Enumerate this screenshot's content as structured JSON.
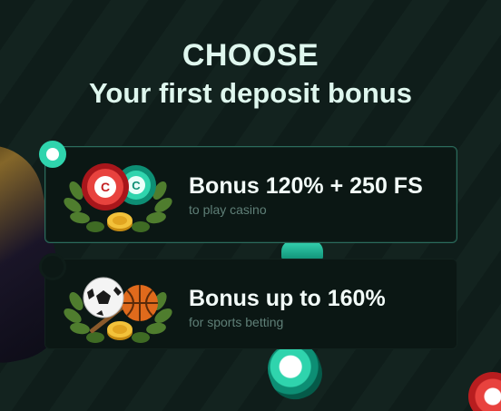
{
  "header": {
    "title_line1": "CHOOSE",
    "title_line2": "Your first deposit bonus"
  },
  "options": [
    {
      "title": "Bonus 120% + 250 FS",
      "subtitle": "to play casino",
      "selected": true,
      "illustration": "casino-chips-icon"
    },
    {
      "title": "Bonus up to 160%",
      "subtitle": "for sports betting",
      "selected": false,
      "illustration": "sports-balls-icon"
    }
  ],
  "colors": {
    "accent": "#2fd4ad",
    "card_bg": "#0b1714",
    "selected_border": "#2b6b5c",
    "title_text": "#dff7ee",
    "subtitle_text": "#5f7f77"
  }
}
